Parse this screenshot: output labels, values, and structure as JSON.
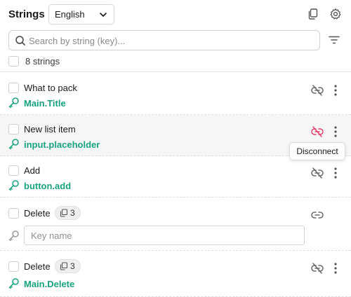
{
  "header": {
    "title": "Strings",
    "language": "English",
    "search_placeholder": "Search by string (key)...",
    "count_label": "8 strings"
  },
  "rows": [
    {
      "label": "What to pack",
      "key": "Main.Title",
      "link_state": "linked"
    },
    {
      "label": "New list item",
      "key": "input.placeholder",
      "link_state": "linked-hover"
    },
    {
      "label": "Add",
      "key": "button.add",
      "link_state": "linked"
    },
    {
      "label": "Delete",
      "badge": "3",
      "key_placeholder": "Key name",
      "link_state": "unlinked"
    },
    {
      "label": "Delete",
      "badge": "3",
      "key": "Main.Delete",
      "link_state": "linked"
    }
  ],
  "tooltip": "Disconnect",
  "colors": {
    "key_green": "#16a37f",
    "disconnect_red": "#e5446d",
    "icon_gray": "#6b6b6b"
  }
}
